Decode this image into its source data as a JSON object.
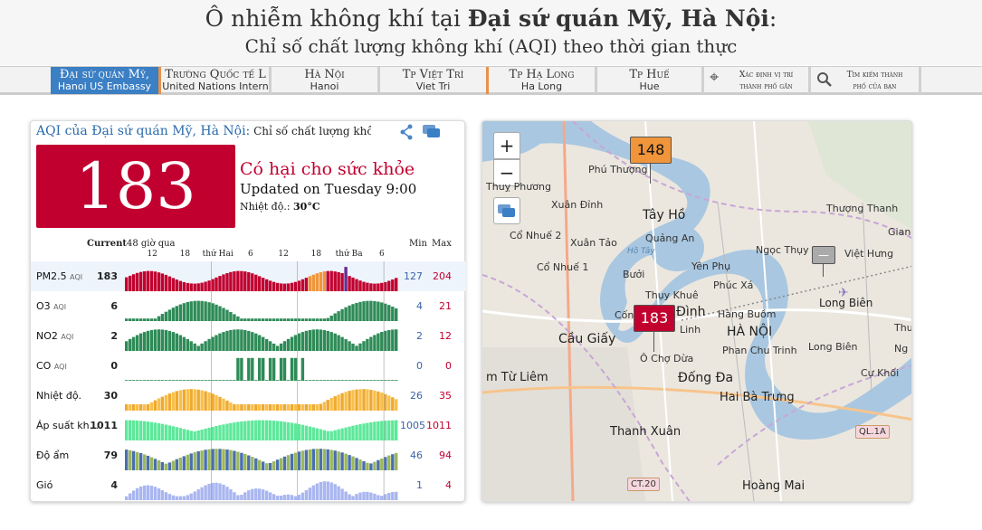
{
  "page_title": {
    "prefix": "Ô nhiễm không khí tại ",
    "location": "Đại sứ quán Mỹ, Hà Nội",
    "suffix": ":",
    "subtitle": "Chỉ số chất lượng không khí (AQI) theo thời gian thực"
  },
  "nav": [
    {
      "line1": "Đại sứ quán Mỹ,",
      "line2": "Hanoi US Embassy"
    },
    {
      "line1": "Trường Quốc tế L",
      "line2": "United Nations Intern"
    },
    {
      "line1": "Hà Nội",
      "line2": "Hanoi"
    },
    {
      "line1": "Tp Việt Trì",
      "line2": "Viet Tri"
    },
    {
      "line1": "Tp Hạ Long",
      "line2": "Ha Long"
    },
    {
      "line1": "Tp Huế",
      "line2": "Hue"
    },
    {
      "line1": "Xác định vị trí",
      "line2": "thành phố gần"
    },
    {
      "line1": "Tìm kiếm thành",
      "line2": "phố của bạn"
    }
  ],
  "card": {
    "title": "AQI của Đại sứ quán Mỹ, Hà Nội:",
    "title_sub": " Chỉ số chất lượng không",
    "aqi": "183",
    "status": "Có hại cho sức khỏe",
    "updated": "Updated on Tuesday 9:00",
    "temp_label": "Nhiệt độ.: ",
    "temp_value": "30°C",
    "colors": {
      "aqi_box": "#c1002f"
    }
  },
  "history": {
    "current_label": "Current",
    "hours_label": "48 giờ qua",
    "min_label": "Min",
    "max_label": "Max",
    "tick_labels": [
      "12",
      "18",
      "thứ Hai",
      "6",
      "12",
      "18",
      "thứ Ba",
      "6"
    ],
    "rows": [
      {
        "label": "PM2.5",
        "sub": "AQI",
        "current": "183",
        "min": "127",
        "max": "204"
      },
      {
        "label": "O3",
        "sub": "AQI",
        "current": "6",
        "min": "4",
        "max": "21"
      },
      {
        "label": "NO2",
        "sub": "AQI",
        "current": "2",
        "min": "2",
        "max": "12"
      },
      {
        "label": "CO",
        "sub": "AQI",
        "current": "0",
        "min": "0",
        "max": "0"
      },
      {
        "label": "Nhiệt độ.",
        "sub": "",
        "current": "30",
        "min": "26",
        "max": "35"
      },
      {
        "label": "Áp suất kh...",
        "sub": "",
        "current": "1011",
        "min": "1005",
        "max": "1011"
      },
      {
        "label": "Độ ẩm",
        "sub": "",
        "current": "79",
        "min": "46",
        "max": "94"
      },
      {
        "label": "Gió",
        "sub": "",
        "current": "4",
        "min": "1",
        "max": "4"
      }
    ]
  },
  "map": {
    "zoom_in": "+",
    "zoom_out": "−",
    "markers": [
      {
        "value": "148",
        "color": "#f0953a"
      },
      {
        "value": "183",
        "color": "#c1002f"
      },
      {
        "value": "—",
        "color": "#aaaaaa"
      }
    ],
    "labels": {
      "phu_thuong": "Phú Thượng",
      "thuy_phuong": "Thuỵ Phương",
      "xuan_dinh": "Xuân Đỉnh",
      "tay_ho": "Tây Hồ",
      "co_nhue2": "Cổ Nhuế 2",
      "quang_an": "Quảng An",
      "xuan_tao": "Xuân Tảo",
      "ho_tay": "Hồ Tây",
      "co_nhue1": "Cổ Nhuế 1",
      "yen_phu": "Yên Phụ",
      "buoi": "Bưởi",
      "thuy_khue": "Thụy Khuê",
      "phuc_xa": "Phúc Xá",
      "ngoc_thuy": "Ngọc Thụy",
      "viet_hung": "Việt Hưng",
      "thuong_thanh": "Thượng Thanh",
      "long_bien": "Long Biên",
      "cau_giay": "Cầu Giấy",
      "ba_dinh": "Đình",
      "linh": "Linh",
      "hang_buom": "Hàng Buồm",
      "ha_noi": "HÀ NỘI",
      "phan_chu_trinh": "Phan Chu Trinh",
      "long_bien2": "Long Biên",
      "o_cho_dua": "Ô Chợ Dừa",
      "dong_da": "Đống Đa",
      "tu_liem": "m Từ Liêm",
      "cu_khoi": "Cự Khối",
      "hai_ba_trung": "Hai Bà Trưng",
      "thanh_xuan": "Thanh Xuân",
      "hoang_mai": "Hoàng Mai",
      "ql1a": "QL.1A",
      "ct20": "CT.20",
      "con": "Cốn",
      "giang": "Giang",
      "thu": "Thu",
      "ng": "Ng"
    }
  }
}
